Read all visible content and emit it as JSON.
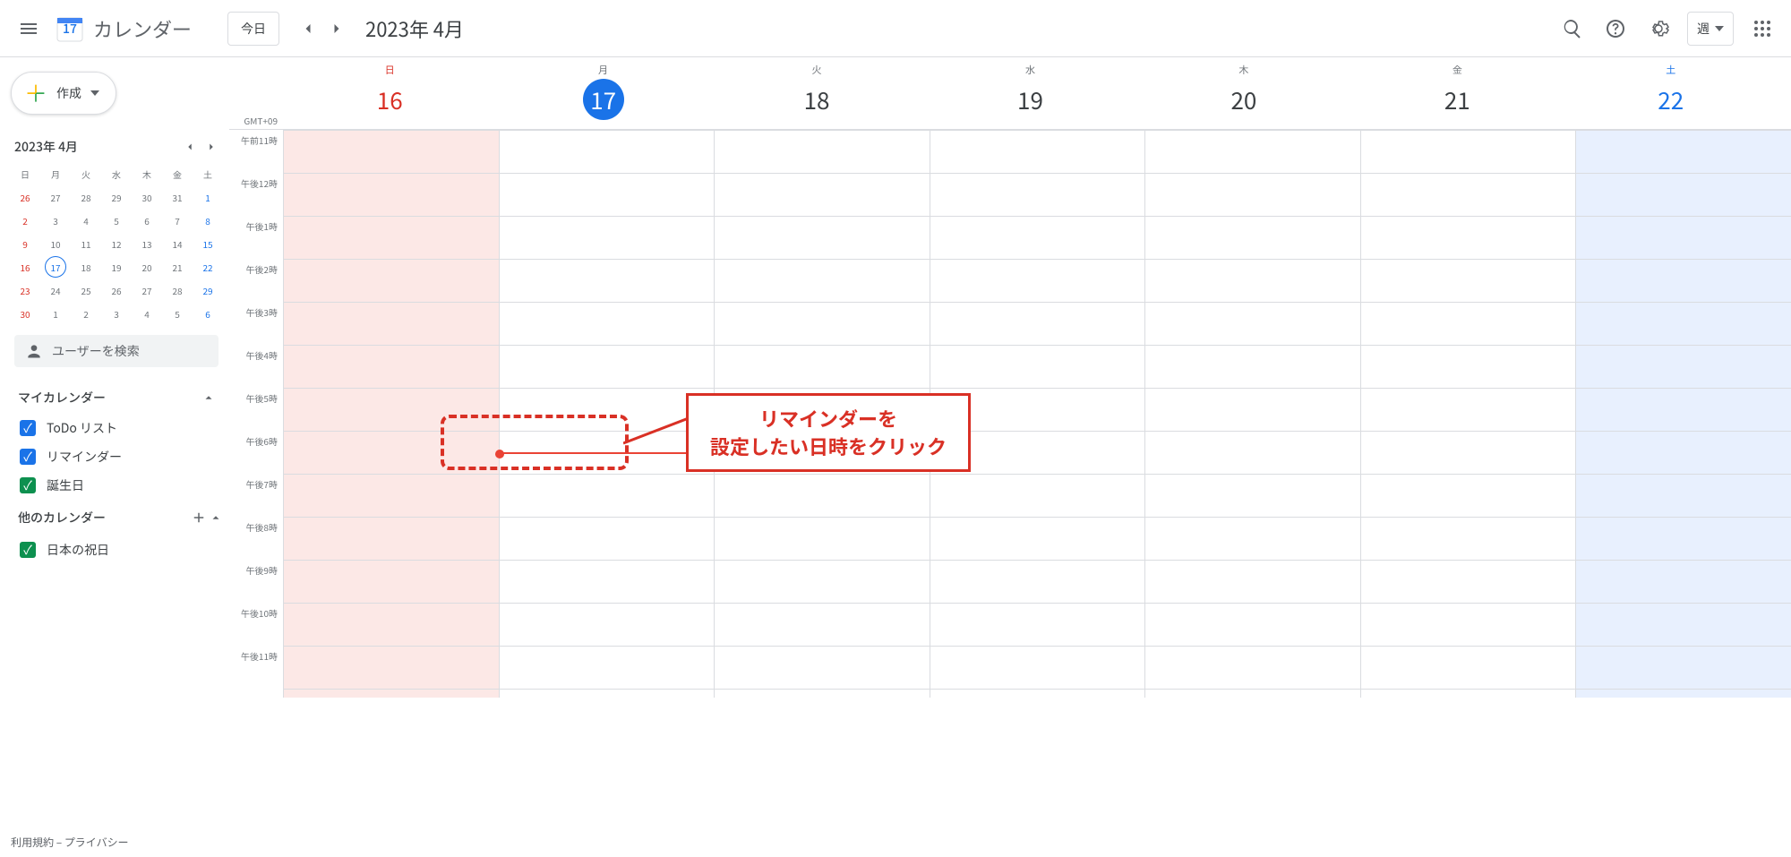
{
  "header": {
    "app_title": "カレンダー",
    "logo_date": "17",
    "today_label": "今日",
    "date_title": "2023年 4月",
    "view_label": "週"
  },
  "sidebar": {
    "create_label": "作成",
    "mini_title": "2023年 4月",
    "mini_dow": [
      "日",
      "月",
      "火",
      "水",
      "木",
      "金",
      "土"
    ],
    "mini_days": [
      {
        "n": "26",
        "cls": "mini-red"
      },
      {
        "n": "27"
      },
      {
        "n": "28"
      },
      {
        "n": "29"
      },
      {
        "n": "30"
      },
      {
        "n": "31"
      },
      {
        "n": "1",
        "cls": "mini-blue"
      },
      {
        "n": "2",
        "cls": "mini-red"
      },
      {
        "n": "3"
      },
      {
        "n": "4"
      },
      {
        "n": "5"
      },
      {
        "n": "6"
      },
      {
        "n": "7"
      },
      {
        "n": "8",
        "cls": "mini-blue"
      },
      {
        "n": "9",
        "cls": "mini-red"
      },
      {
        "n": "10"
      },
      {
        "n": "11"
      },
      {
        "n": "12"
      },
      {
        "n": "13"
      },
      {
        "n": "14"
      },
      {
        "n": "15",
        "cls": "mini-blue"
      },
      {
        "n": "16",
        "cls": "mini-red"
      },
      {
        "n": "17",
        "cls": "mini-today"
      },
      {
        "n": "18"
      },
      {
        "n": "19"
      },
      {
        "n": "20"
      },
      {
        "n": "21"
      },
      {
        "n": "22",
        "cls": "mini-blue"
      },
      {
        "n": "23",
        "cls": "mini-red"
      },
      {
        "n": "24"
      },
      {
        "n": "25"
      },
      {
        "n": "26"
      },
      {
        "n": "27"
      },
      {
        "n": "28"
      },
      {
        "n": "29",
        "cls": "mini-blue"
      },
      {
        "n": "30",
        "cls": "mini-red"
      },
      {
        "n": "1"
      },
      {
        "n": "2"
      },
      {
        "n": "3"
      },
      {
        "n": "4"
      },
      {
        "n": "5"
      },
      {
        "n": "6",
        "cls": "mini-blue"
      }
    ],
    "search_placeholder": "ユーザーを検索",
    "my_cal_label": "マイカレンダー",
    "my_cals": [
      {
        "label": "ToDo リスト",
        "color": "#1a73e8"
      },
      {
        "label": "リマインダー",
        "color": "#1a73e8"
      },
      {
        "label": "誕生日",
        "color": "#0d904f"
      }
    ],
    "other_cal_label": "他のカレンダー",
    "other_cals": [
      {
        "label": "日本の祝日",
        "color": "#0d904f"
      }
    ],
    "footer": "利用規約 – プライバシー"
  },
  "grid": {
    "tz_label": "GMT+09",
    "days": [
      {
        "dow": "日",
        "num": "16",
        "type": "sun"
      },
      {
        "dow": "月",
        "num": "17",
        "type": "today"
      },
      {
        "dow": "火",
        "num": "18",
        "type": ""
      },
      {
        "dow": "水",
        "num": "19",
        "type": ""
      },
      {
        "dow": "木",
        "num": "20",
        "type": ""
      },
      {
        "dow": "金",
        "num": "21",
        "type": ""
      },
      {
        "dow": "土",
        "num": "22",
        "type": "sat"
      }
    ],
    "hours": [
      "午前11時",
      "午後12時",
      "午後1時",
      "午後2時",
      "午後3時",
      "午後4時",
      "午後5時",
      "午後6時",
      "午後7時",
      "午後8時",
      "午後9時",
      "午後10時",
      "午後11時"
    ]
  },
  "annotation": {
    "line1": "リマインダーを",
    "line2": "設定したい日時をクリック"
  }
}
